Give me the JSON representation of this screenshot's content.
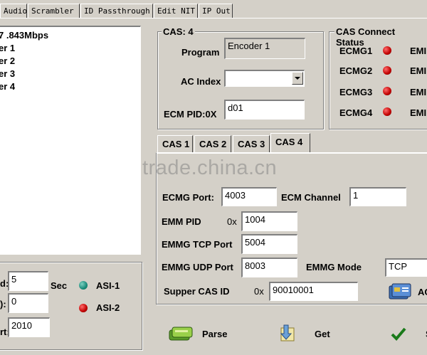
{
  "top_tabs": [
    "Audio",
    "Scrambler",
    "ID Passthrough",
    "Edit NIT",
    "IP Out"
  ],
  "left_list": {
    "items": [
      "7 .843Mbps",
      "er 1",
      "er 2",
      "er 3",
      "er 4"
    ]
  },
  "left_bottom": {
    "field1_label": "d:",
    "field1_value": "5",
    "field1_unit": "Sec",
    "field2_label": "):",
    "field2_value": "0",
    "field3_label": "rt:",
    "field3_value": "2010",
    "asi1_label": "ASI-1",
    "asi2_label": "ASI-2"
  },
  "cas_group": {
    "title": "CAS: 4",
    "program_label": "Program",
    "program_value": "Encoder 1",
    "ac_index_label": "AC Index",
    "ac_index_value": "",
    "ecm_pid_label": "ECM PID:0X",
    "ecm_pid_value": "d01"
  },
  "status_group": {
    "title": "CAS Connect Status",
    "ecmg": [
      "ECMG1",
      "ECMG2",
      "ECMG3",
      "ECMG4"
    ],
    "emm": [
      "EMI",
      "EMI",
      "EMI",
      "EMI"
    ]
  },
  "cas_tabs": [
    "CAS 1",
    "CAS 2",
    "CAS 3",
    "CAS 4"
  ],
  "cas_detail": {
    "ecmg_port_label": "ECMG Port:",
    "ecmg_port_value": "4003",
    "ecm_channel_label": "ECM Channel",
    "ecm_channel_value": "1",
    "emm_pid_label": "EMM PID",
    "emm_pid_prefix": "0x",
    "emm_pid_value": "1004",
    "emmg_tcp_label": "EMMG TCP Port",
    "emmg_tcp_value": "5004",
    "emmg_udp_label": "EMMG UDP Port",
    "emmg_udp_value": "8003",
    "emmg_mode_label": "EMMG Mode",
    "emmg_mode_value": "TCP",
    "super_cas_label": "Supper CAS ID",
    "super_cas_prefix": "0x",
    "super_cas_value": "90010001",
    "ac_button_label": "AC"
  },
  "buttons": {
    "parse": "Parse",
    "get": "Get",
    "set": "S"
  },
  "watermark": "trade.china.cn",
  "colors": {
    "window_bg": "#d4d0c8",
    "led_red": "#c00000",
    "led_green": "#1a8a7a"
  }
}
